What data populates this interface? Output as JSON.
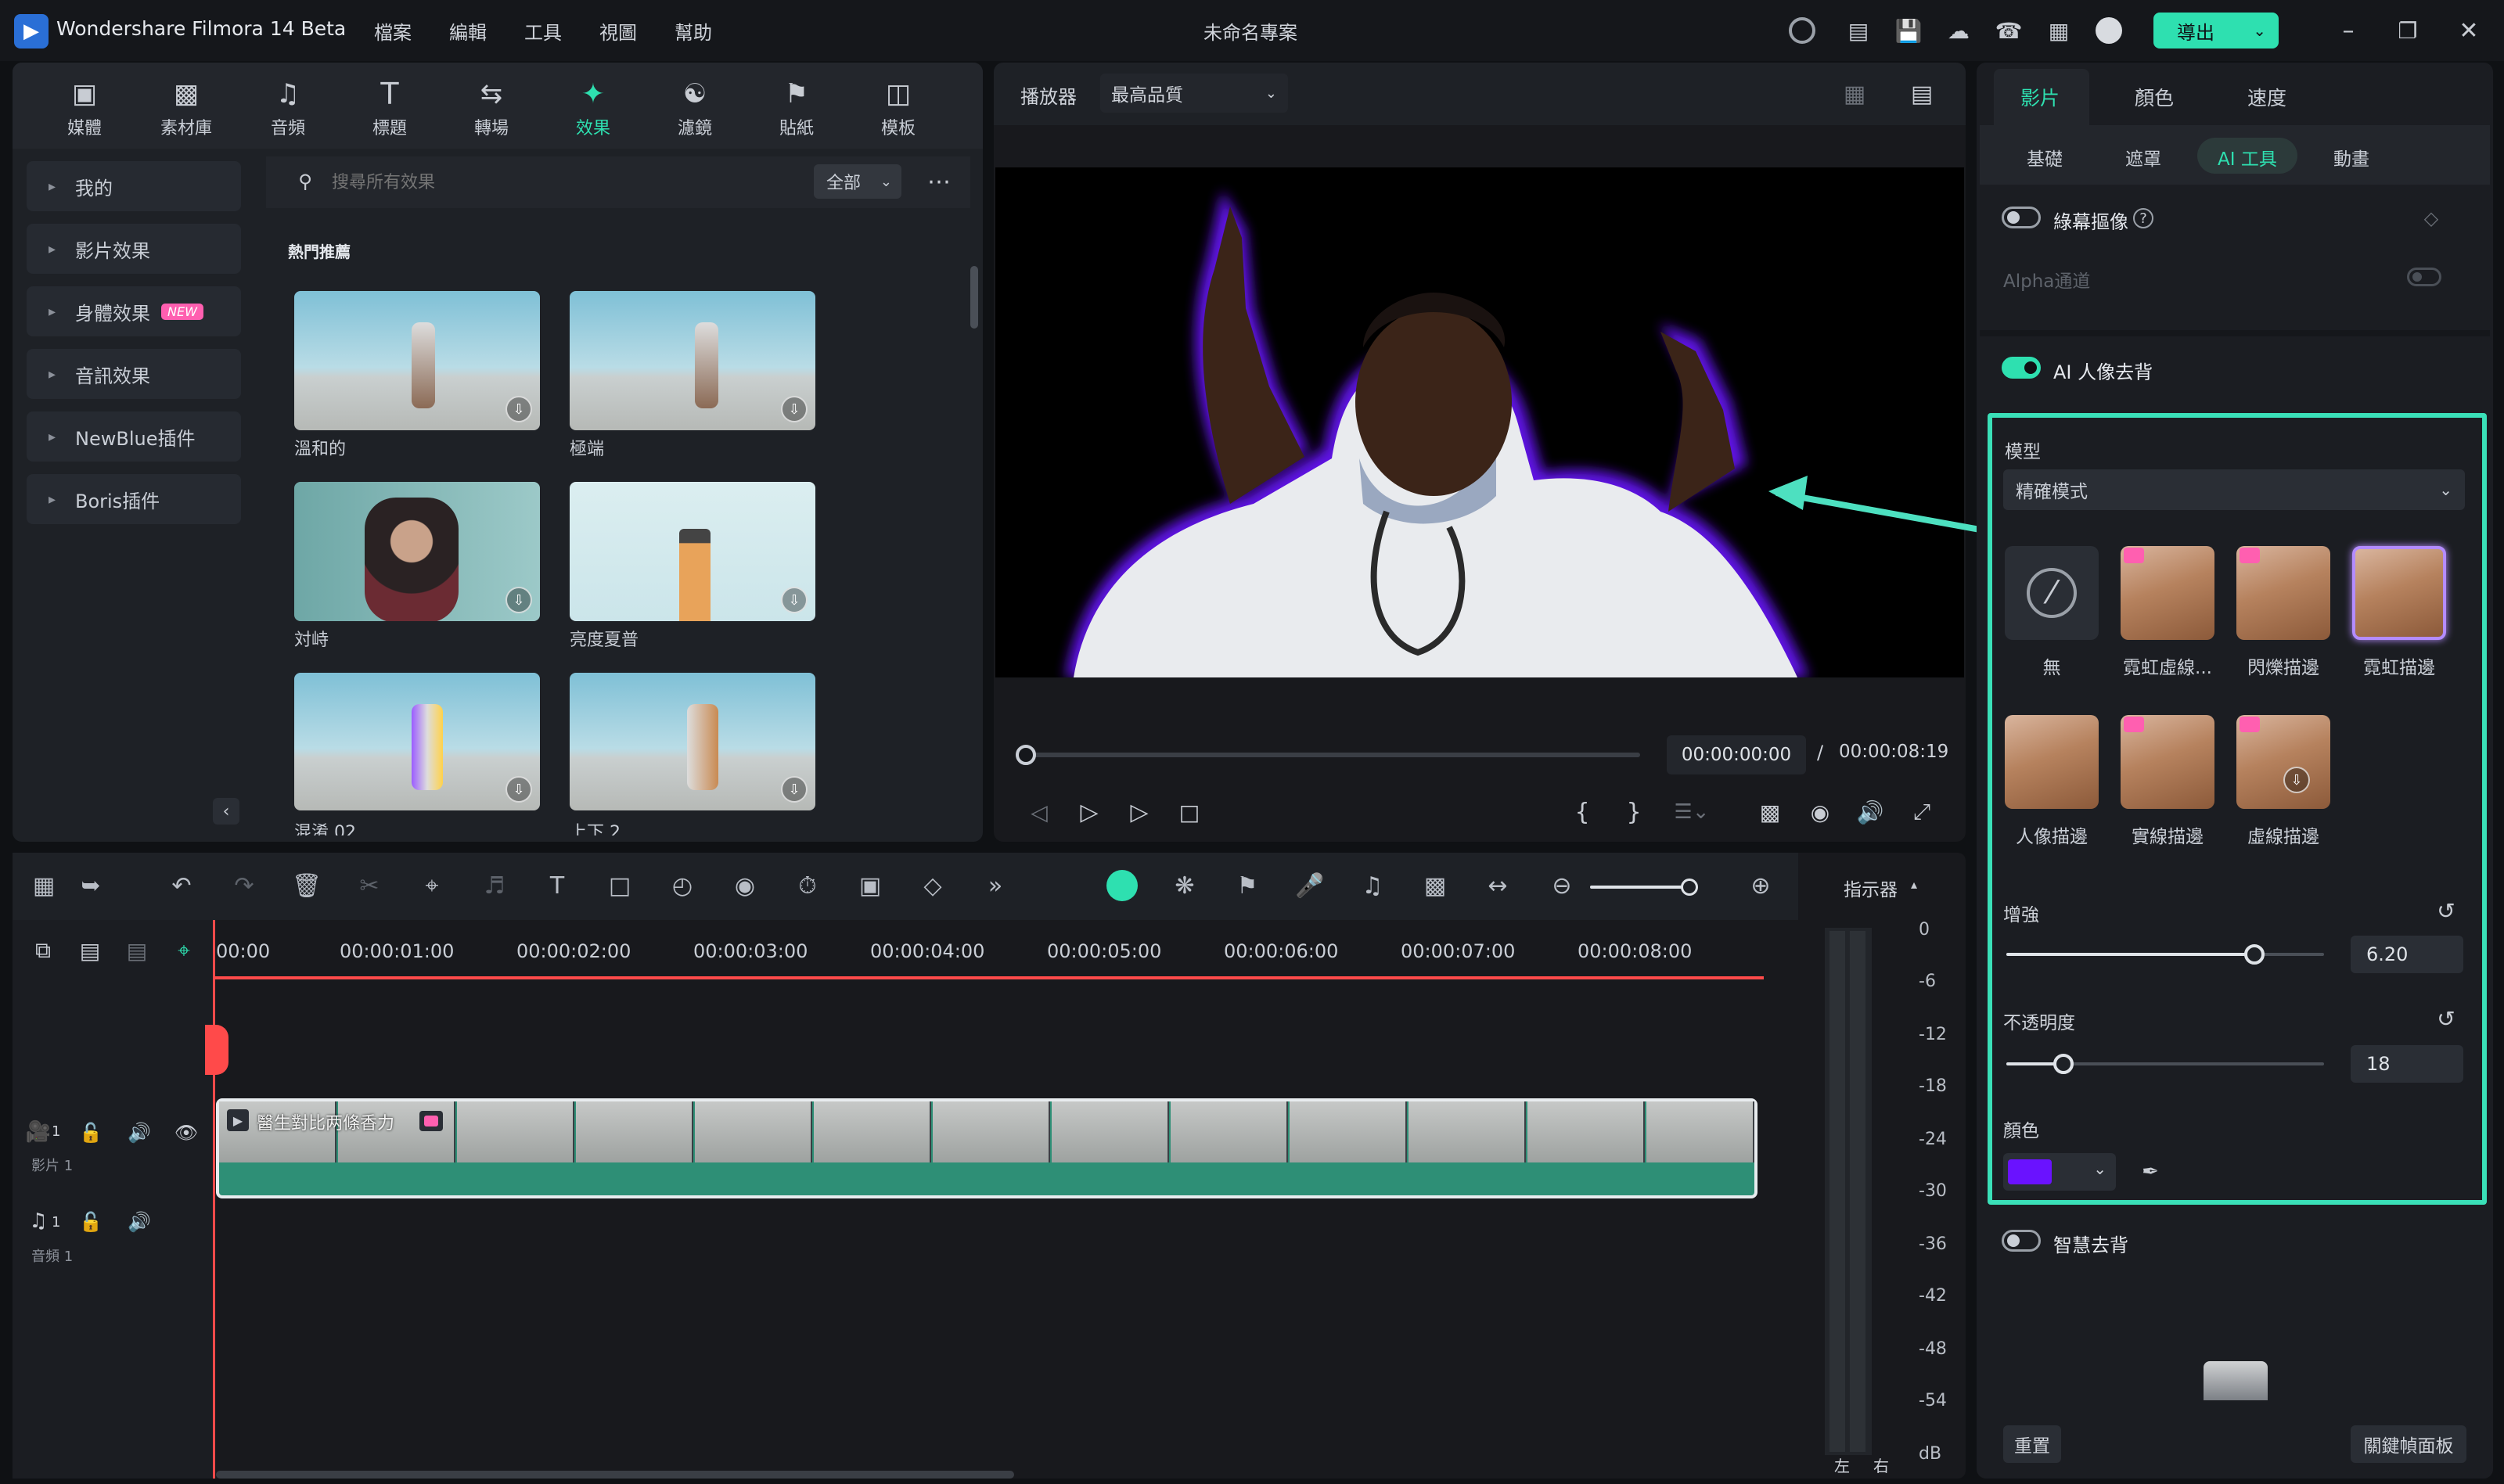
{
  "app": {
    "name": "Wondershare Filmora 14 Beta",
    "project_title": "未命名專案",
    "export_label": "導出"
  },
  "menu": [
    "檔案",
    "編輯",
    "工具",
    "視圖",
    "幫助"
  ],
  "toolbar": [
    {
      "label": "媒體",
      "icon": "media-icon"
    },
    {
      "label": "素材庫",
      "icon": "stock-icon"
    },
    {
      "label": "音頻",
      "icon": "audio-icon"
    },
    {
      "label": "標題",
      "icon": "title-icon"
    },
    {
      "label": "轉場",
      "icon": "transition-icon"
    },
    {
      "label": "效果",
      "icon": "effects-icon"
    },
    {
      "label": "濾鏡",
      "icon": "filter-icon"
    },
    {
      "label": "貼紙",
      "icon": "sticker-icon"
    },
    {
      "label": "模板",
      "icon": "template-icon"
    }
  ],
  "sidebar": {
    "items": [
      "我的",
      "影片效果",
      "身體效果",
      "音訊效果",
      "NewBlue插件",
      "Boris插件"
    ],
    "new_badge": "NEW"
  },
  "library": {
    "search_placeholder": "搜尋所有效果",
    "filter": "全部",
    "section": "熱門推薦",
    "effects": [
      "溫和的",
      "極端",
      "対峙",
      "亮度夏普",
      "混淆 02",
      "上下 2"
    ]
  },
  "player": {
    "label": "播放器",
    "quality": "最高品質",
    "current_time": "00:00:00:00",
    "separator": "/",
    "total_time": "00:00:08:19"
  },
  "timeline": {
    "indicator_label": "指示器",
    "ruler": [
      "00:00",
      "00:00:01:00",
      "00:00:02:00",
      "00:00:03:00",
      "00:00:04:00",
      "00:00:05:00",
      "00:00:06:00",
      "00:00:07:00",
      "00:00:08:00"
    ],
    "video_track": {
      "number": "1",
      "name": "影片 1"
    },
    "audio_track": {
      "number": "1",
      "name": "音頻 1"
    },
    "clip_title": "醫生對比两條香力"
  },
  "meter": {
    "marks": [
      "0",
      "-6",
      "-12",
      "-18",
      "-24",
      "-30",
      "-36",
      "-42",
      "-48",
      "-54",
      "dB"
    ],
    "left": "左",
    "right": "右"
  },
  "properties": {
    "tabs": [
      "影片",
      "顏色",
      "速度"
    ],
    "subtabs": [
      "基礎",
      "遮罩",
      "AI 工具",
      "動畫"
    ],
    "chroma_key": "綠幕摳像",
    "alpha": "Alpha通道",
    "ai_portrait": "AI 人像去背",
    "model_label": "模型",
    "model_value": "精確模式",
    "presets": [
      "無",
      "霓虹虛線...",
      "閃爍描邊",
      "霓虹描邊",
      "人像描邊",
      "實線描邊",
      "虛線描邊"
    ],
    "enhance_label": "增強",
    "enhance_value": "6.20",
    "enhance_level": 0.78,
    "opacity_label": "不透明度",
    "opacity_value": "18",
    "opacity_level": 0.18,
    "color_label": "顏色",
    "color_value": "#6a12ff",
    "smart_cutout": "智慧去背",
    "reset": "重置",
    "keyframe_panel": "關鍵幀面板"
  },
  "colors": {
    "accent": "#2ee0b0",
    "playhead": "#ff4a4a",
    "stroke": "#6a12ff"
  }
}
